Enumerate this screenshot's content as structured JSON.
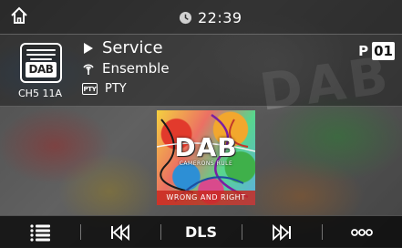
{
  "status_bar": {
    "time": "22:39"
  },
  "station": {
    "service": "Service",
    "ensemble": "Ensemble",
    "pty_badge": "PTY",
    "pty": "PTY",
    "channel": "CH5 11A",
    "logo_text": "DAB",
    "preset_label": "P",
    "preset_number": "01"
  },
  "album_art": {
    "title": "DAB",
    "artist": "CAMERONS RULE",
    "album": "WRONG AND RIGHT"
  },
  "background_word": "DAB",
  "toolbar": {
    "dls_label": "DLS",
    "items": [
      "list-icon",
      "skip-back-icon",
      "DLS",
      "skip-forward-icon",
      "more-icon"
    ]
  },
  "colors": {
    "text": "#ffffff",
    "bar_background": "#0a0a0a",
    "album_banner": "#c8281e"
  }
}
